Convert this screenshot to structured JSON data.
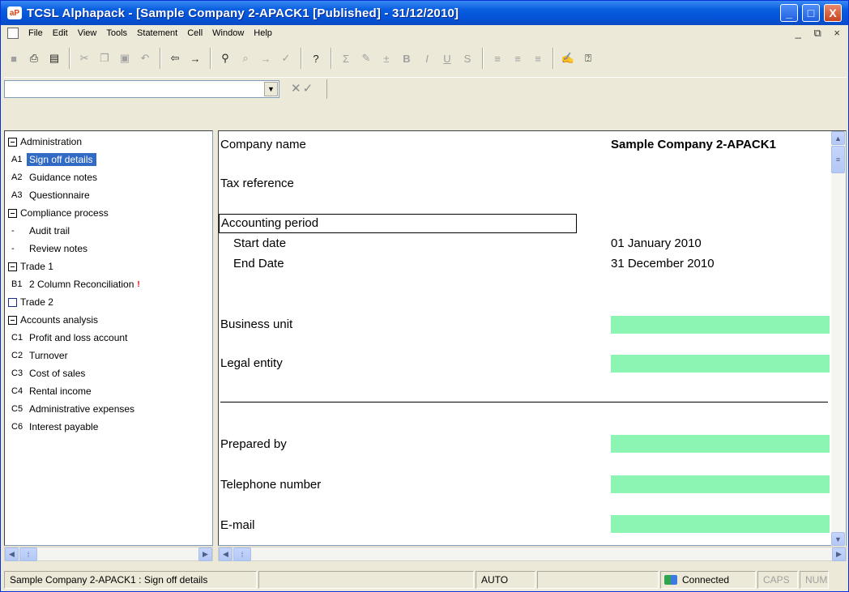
{
  "window": {
    "title": "TCSL Alphapack - [Sample Company 2-APACK1 [Published] - 31/12/2010]",
    "app_icon_text": "aP",
    "minimize": "_",
    "maximize": "□",
    "close": "X"
  },
  "menu": {
    "items": [
      "File",
      "Edit",
      "View",
      "Tools",
      "Statement",
      "Cell",
      "Window",
      "Help"
    ],
    "child_controls": "_ ⧉ ×"
  },
  "formula_bar": {
    "combo_value": "",
    "cancel": "✕",
    "accept": "✓"
  },
  "tree": {
    "sections": [
      {
        "label": "Administration",
        "items": [
          {
            "code": "A1",
            "label": "Sign off details",
            "selected": true
          },
          {
            "code": "A2",
            "label": "Guidance notes"
          },
          {
            "code": "A3",
            "label": "Questionnaire"
          }
        ]
      },
      {
        "label": "Compliance process",
        "items": [
          {
            "code": "-",
            "label": "Audit trail"
          },
          {
            "code": "-",
            "label": "Review notes"
          }
        ]
      },
      {
        "label": "Trade 1",
        "items": [
          {
            "code": "B1",
            "label": "2 Column Reconciliation",
            "flag": "!"
          }
        ]
      },
      {
        "label": "Trade 2",
        "items": []
      },
      {
        "label": "Accounts analysis",
        "items": [
          {
            "code": "C1",
            "label": "Profit and loss account"
          },
          {
            "code": "C2",
            "label": "Turnover"
          },
          {
            "code": "C3",
            "label": "Cost of sales"
          },
          {
            "code": "C4",
            "label": "Rental income"
          },
          {
            "code": "C5",
            "label": "Administrative expenses"
          },
          {
            "code": "C6",
            "label": "Interest payable"
          }
        ]
      }
    ]
  },
  "form": {
    "company_name_label": "Company name",
    "company_name_value": "Sample Company 2-APACK1",
    "tax_reference_label": "Tax reference",
    "accounting_period_label": "Accounting period",
    "start_date_label": "Start date",
    "start_date_value": "01 January 2010",
    "end_date_label": "End Date",
    "end_date_value": "31 December 2010",
    "business_unit_label": "Business unit",
    "legal_entity_label": "Legal entity",
    "prepared_by_label": "Prepared by",
    "telephone_label": "Telephone number",
    "email_label": "E-mail",
    "input_color": "#8cf5b4"
  },
  "status": {
    "document": "Sample Company 2-APACK1 : Sign off details",
    "mode": "AUTO",
    "connection": "Connected",
    "caps": "CAPS",
    "num": "NUM"
  }
}
